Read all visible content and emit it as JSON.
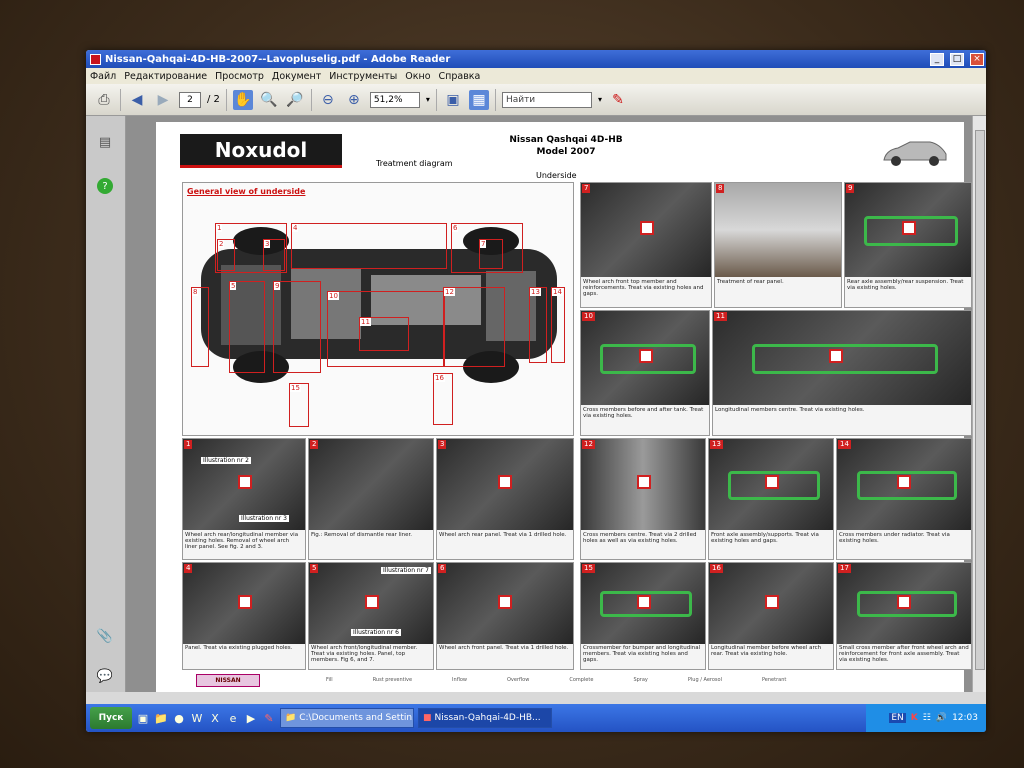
{
  "window": {
    "title": "Nissan-Qahqai-4D-HB-2007--Lavopluselig.pdf - Adobe Reader",
    "buttons": [
      "_",
      "□",
      "×"
    ]
  },
  "menu": [
    "Файл",
    "Редактирование",
    "Просмотр",
    "Документ",
    "Инструменты",
    "Окно",
    "Справка"
  ],
  "toolbar": {
    "page_current": "2",
    "page_total": "/ 2",
    "zoom": "51,2%",
    "search_placeholder": "Найти"
  },
  "document": {
    "logo": "Noxudol",
    "title": "Nissan Qashqai 4D-HB",
    "model": "Model 2007",
    "subtitle": "Treatment diagram",
    "section": "Underside",
    "general_view": "General view of underside",
    "footer_tag": "NISSAN",
    "legend": [
      "Fill",
      "Rust preventive",
      "Inflow",
      "Overflow",
      "Complete",
      "Spray",
      "Plug / Aerosol",
      "Penetrant"
    ],
    "underside_markers": [
      "1",
      "2",
      "3",
      "4",
      "5",
      "6",
      "7",
      "8",
      "9",
      "10",
      "11",
      "12",
      "13",
      "14",
      "15",
      "16",
      "17"
    ],
    "tiles_right_top": [
      {
        "num": "7",
        "caption": "Wheel arch front top member and reinforcements. Treat via existing holes and gaps.",
        "green": false
      },
      {
        "num": "8",
        "caption": "Treatment of rear panel.",
        "green": false
      },
      {
        "num": "9",
        "caption": "Rear axle assembly/rear suspension. Treat via existing holes.",
        "green": true
      },
      {
        "num": "10",
        "caption": "Cross members before and after tank. Treat via existing holes.",
        "green": true
      },
      {
        "num": "11",
        "caption": "Longitudinal members centre. Treat via existing holes.",
        "green": true
      }
    ],
    "tiles_bottom": [
      {
        "num": "1",
        "caption": "Wheel arch rear/longitudinal member via existing holes. Removal of wheel arch liner panel. See fig. 2 and 3.",
        "green": false,
        "labels": [
          "Illustration nr 2",
          "Illustration nr 3"
        ]
      },
      {
        "num": "2",
        "caption": "Fig.: Removal of dismantle rear liner.",
        "green": false
      },
      {
        "num": "3",
        "caption": "Wheel arch rear panel. Treat via 1 drilled hole.",
        "green": false
      },
      {
        "num": "12",
        "caption": "Cross members centre. Treat via 2 drilled holes as well as via existing holes.",
        "green": false
      },
      {
        "num": "13",
        "caption": "Front axle assembly/supports. Treat via existing holes and gaps.",
        "green": true
      },
      {
        "num": "14",
        "caption": "Cross members under radiator. Treat via existing holes.",
        "green": true
      },
      {
        "num": "4",
        "caption": "Panel. Treat via existing plugged holes.",
        "green": false
      },
      {
        "num": "5",
        "caption": "Wheel arch front/longitudinal member. Treat via existing holes. Panel, top members. Fig 6, and 7.",
        "green": false,
        "labels": [
          "Illustration nr 7",
          "Illustration nr 6"
        ]
      },
      {
        "num": "6",
        "caption": "Wheel arch front panel. Treat via 1 drilled hole.",
        "green": false
      },
      {
        "num": "15",
        "caption": "Crossmember for bumper and longitudinal members. Treat via existing holes and gaps.",
        "green": true
      },
      {
        "num": "16",
        "caption": "Longitudinal member before wheel arch rear. Treat via existing hole.",
        "green": false
      },
      {
        "num": "17",
        "caption": "Small cross member after front wheel arch and reinforcement for front axle assembly. Treat via existing holes.",
        "green": true
      }
    ]
  },
  "taskbar": {
    "start": "Пуск",
    "tasks": [
      {
        "label": "C:\\Documents and Settin...",
        "active": false
      },
      {
        "label": "Nissan-Qahqai-4D-HB...",
        "active": true
      }
    ],
    "clock": "12:03"
  }
}
